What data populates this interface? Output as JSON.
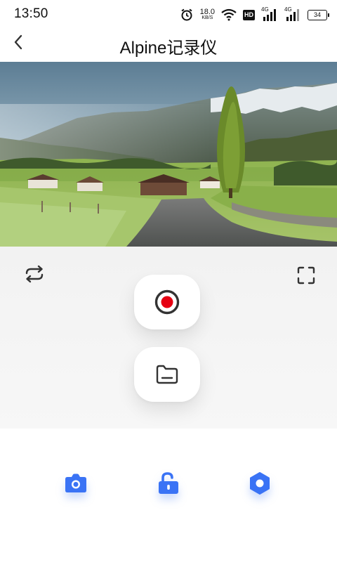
{
  "status_bar": {
    "time": "13:50",
    "speed_value": "18.0",
    "speed_unit": "KB/S",
    "hd_label": "HD",
    "net1": "4G",
    "net2": "4G",
    "battery": "34"
  },
  "header": {
    "title": "Alpine记录仪",
    "back_icon": "chevron-left-icon"
  },
  "hero": {
    "alt": "alpine-landscape-photo"
  },
  "controls": {
    "loop_icon": "repeat-icon",
    "fullscreen_icon": "fullscreen-icon",
    "record_icon": "record-icon",
    "folder_icon": "folder-icon",
    "record_color": "#e60012"
  },
  "tabs": [
    {
      "icon": "camera-icon"
    },
    {
      "icon": "unlock-icon"
    },
    {
      "icon": "settings-hexagon-icon"
    }
  ],
  "colors": {
    "accent": "#3a73f5"
  }
}
